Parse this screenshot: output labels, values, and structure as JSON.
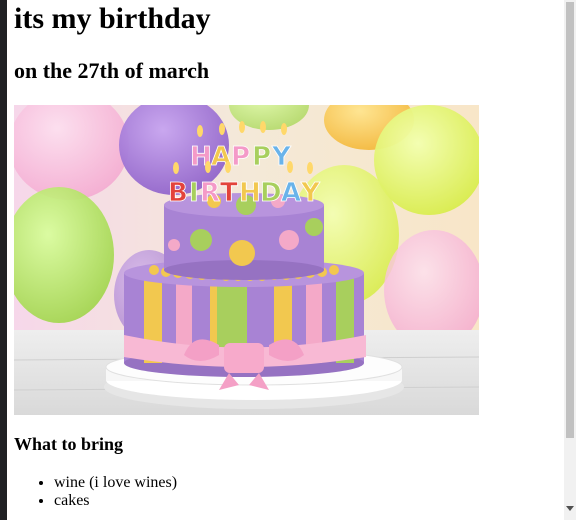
{
  "page": {
    "title": "its my birthday",
    "subtitle": "on the 27th of march",
    "image": {
      "subject": "birthday cake with Happy Birthday candles and balloons",
      "candle_text_top": "HAPPY",
      "candle_text_bottom": "BIRTHDAY"
    },
    "section_heading": "What to bring",
    "bring_items": [
      "wine (i love wines)",
      "cakes"
    ]
  },
  "colors": {
    "cake_purple": "#a883d4",
    "cake_pink": "#f4a9c8",
    "cake_green": "#a8cf5d",
    "cake_yellow": "#f2c84f",
    "scrollbar_thumb": "#c1c1c1"
  },
  "icons": {
    "list_bullet": "disc",
    "scroll_down": "scroll-down-arrow-icon"
  }
}
